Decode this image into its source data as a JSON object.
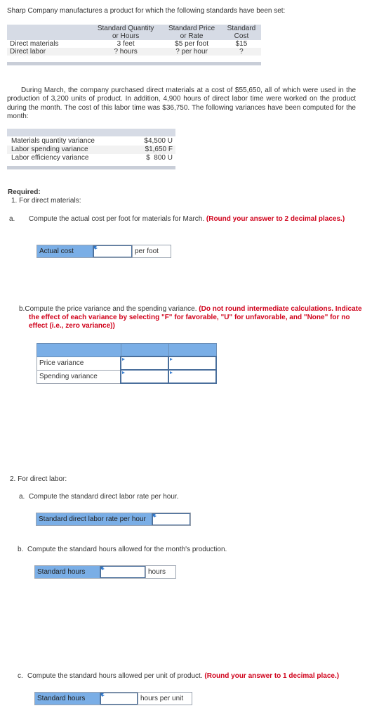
{
  "intro": "Sharp Company manufactures a product for which the following standards have been set:",
  "standards_table": {
    "headers": [
      "",
      "Standard Quantity or Hours",
      "Standard Price or Rate",
      "Standard Cost"
    ],
    "header_lines": [
      [
        "",
        ""
      ],
      [
        "Standard Quantity",
        "or Hours"
      ],
      [
        "Standard Price",
        "or Rate"
      ],
      [
        "Standard",
        "Cost"
      ]
    ],
    "rows": [
      [
        "Direct materials",
        "3 feet",
        "$5 per foot",
        "$15"
      ],
      [
        "Direct labor",
        "? hours",
        "? per hour",
        "?"
      ]
    ]
  },
  "paragraph": "During March, the company purchased direct materials at a cost of $55,650, all of which were used in the production of 3,200 units of product. In addition, 4,900 hours of direct labor time were worked on the product during the month. The cost of this labor time was $36,750. The following variances have been computed for the month:",
  "variances_table": {
    "rows": [
      [
        "Materials quantity variance",
        "$4,500 U"
      ],
      [
        "Labor spending variance",
        "$1,650 F"
      ],
      [
        "Labor efficiency variance",
        "$  800 U"
      ]
    ]
  },
  "required": "Required:",
  "part1": {
    "title": "1. For direct materials:",
    "a": {
      "label": "a.",
      "text": "Compute the actual cost per foot for materials for March.",
      "instruction": "(Round your answer to 2 decimal places.)",
      "field_label": "Actual cost",
      "value": "",
      "unit": "per foot"
    },
    "b": {
      "label": "b.",
      "text": "Compute the price variance and the spending variance.",
      "instruction": "(Do not round intermediate calculations. Indicate the effect of each variance by selecting \"F\" for favorable, \"U\" for unfavorable, and \"None\" for no effect (i.e., zero variance))",
      "rows": [
        {
          "label": "Price variance",
          "amount": "",
          "effect": ""
        },
        {
          "label": "Spending variance",
          "amount": "",
          "effect": ""
        }
      ]
    }
  },
  "part2": {
    "title": "2. For direct labor:",
    "a": {
      "label": "a.",
      "text": "Compute the standard direct labor rate per hour.",
      "field_label": "Standard direct labor rate per hour",
      "value": ""
    },
    "b": {
      "label": "b.",
      "text": "Compute the standard hours allowed for the month's production.",
      "field_label": "Standard hours",
      "value": "",
      "unit": "hours"
    },
    "c": {
      "label": "c.",
      "text": "Compute the standard hours allowed per unit of product.",
      "instruction": "(Round your answer to 1 decimal place.)",
      "field_label": "Standard hours",
      "value": "",
      "unit": "hours per unit"
    }
  }
}
